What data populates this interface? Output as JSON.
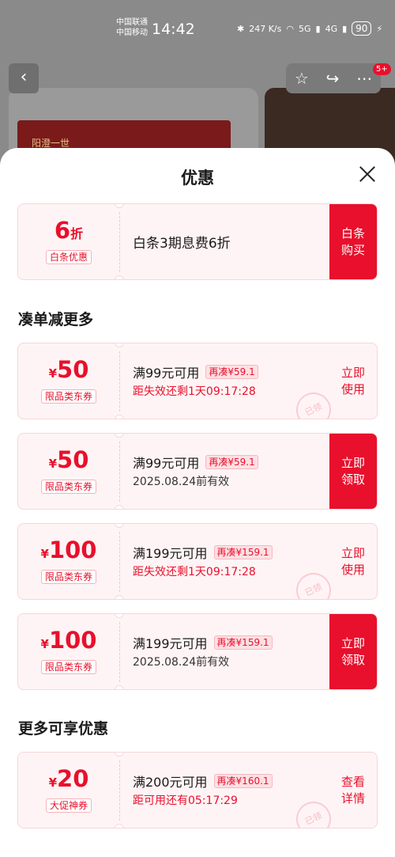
{
  "status_bar": {
    "carrier_1": "中国联通",
    "carrier_2": "中国移动",
    "time": "14:42",
    "speed": "247 K/s",
    "network_1": "5G",
    "network_2": "4G",
    "battery": "90"
  },
  "background": {
    "badge": "5+",
    "product_text": "阳澄一世"
  },
  "sheet": {
    "title": "优惠",
    "baitiao": {
      "amount": "6",
      "unit": "折",
      "tag": "白条优惠",
      "text": "白条3期息费6折",
      "action_line1": "白条",
      "action_line2": "购买"
    },
    "section1_title": "凑单减更多",
    "section2_title": "更多可享优惠",
    "coupons": [
      {
        "currency": "¥",
        "amount": "50",
        "tag": "限品类东券",
        "condition": "满99元可用",
        "extra": "再凑¥59.1",
        "sub": "距失效还剩1天09:17:28",
        "action_line1": "立即",
        "action_line2": "使用",
        "stamp": "已领"
      },
      {
        "currency": "¥",
        "amount": "50",
        "tag": "限品类东券",
        "condition": "满99元可用",
        "extra": "再凑¥59.1",
        "sub": "2025.08.24前有效",
        "action_line1": "立即",
        "action_line2": "领取"
      },
      {
        "currency": "¥",
        "amount": "100",
        "tag": "限品类东券",
        "condition": "满199元可用",
        "extra": "再凑¥159.1",
        "sub": "距失效还剩1天09:17:28",
        "action_line1": "立即",
        "action_line2": "使用",
        "stamp": "已领"
      },
      {
        "currency": "¥",
        "amount": "100",
        "tag": "限品类东券",
        "condition": "满199元可用",
        "extra": "再凑¥159.1",
        "sub": "2025.08.24前有效",
        "action_line1": "立即",
        "action_line2": "领取"
      },
      {
        "currency": "¥",
        "amount": "20",
        "tag": "大促神券",
        "condition": "满200元可用",
        "extra": "再凑¥160.1",
        "sub": "距可用还有05:17:29",
        "action_line1": "查看",
        "action_line2": "详情",
        "stamp": "已领"
      }
    ]
  },
  "colors": {
    "accent": "#e8102c",
    "coupon_bg": "#fff4f5"
  }
}
